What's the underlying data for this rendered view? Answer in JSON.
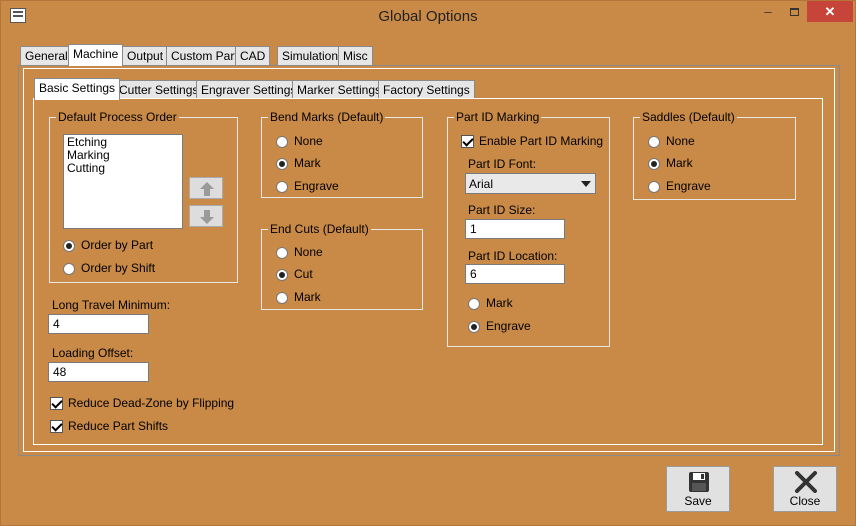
{
  "window": {
    "title": "Global Options",
    "min_glyph": "–",
    "close_glyph": "✕"
  },
  "main_tabs": [
    "General",
    "Machine",
    "Output",
    "Custom Part",
    "CAD",
    "Simulation",
    "Misc"
  ],
  "sub_tabs": [
    "Basic Settings",
    "Cutter Settings",
    "Engraver Settings",
    "Marker Settings",
    "Factory Settings"
  ],
  "process_order": {
    "title": "Default Process Order",
    "items": [
      "Etching",
      "Marking",
      "Cutting"
    ],
    "options": [
      {
        "label": "Order by Part",
        "selected": true
      },
      {
        "label": "Order by Shift",
        "selected": false
      }
    ]
  },
  "long_travel": {
    "label": "Long Travel Minimum:",
    "value": "4"
  },
  "loading_offset": {
    "label": "Loading Offset:",
    "value": "48"
  },
  "checks": [
    {
      "label": "Reduce Dead-Zone by Flipping",
      "checked": true
    },
    {
      "label": "Reduce Part Shifts",
      "checked": true
    }
  ],
  "bend_marks": {
    "title": "Bend Marks (Default)",
    "options": [
      {
        "label": "None",
        "selected": false
      },
      {
        "label": "Mark",
        "selected": true
      },
      {
        "label": "Engrave",
        "selected": false
      }
    ]
  },
  "end_cuts": {
    "title": "End Cuts (Default)",
    "options": [
      {
        "label": "None",
        "selected": false
      },
      {
        "label": "Cut",
        "selected": true
      },
      {
        "label": "Mark",
        "selected": false
      }
    ]
  },
  "part_id": {
    "title": "Part ID Marking",
    "enable_label": "Enable Part ID Marking",
    "enabled": true,
    "font_label": "Part ID Font:",
    "font_value": "Arial",
    "size_label": "Part ID Size:",
    "size_value": "1",
    "location_label": "Part ID Location:",
    "location_value": "6",
    "options": [
      {
        "label": "Mark",
        "selected": false
      },
      {
        "label": "Engrave",
        "selected": true
      }
    ]
  },
  "saddles": {
    "title": "Saddles (Default)",
    "options": [
      {
        "label": "None",
        "selected": false
      },
      {
        "label": "Mark",
        "selected": true
      },
      {
        "label": "Engrave",
        "selected": false
      }
    ]
  },
  "buttons": {
    "save": "Save",
    "close": "Close"
  }
}
